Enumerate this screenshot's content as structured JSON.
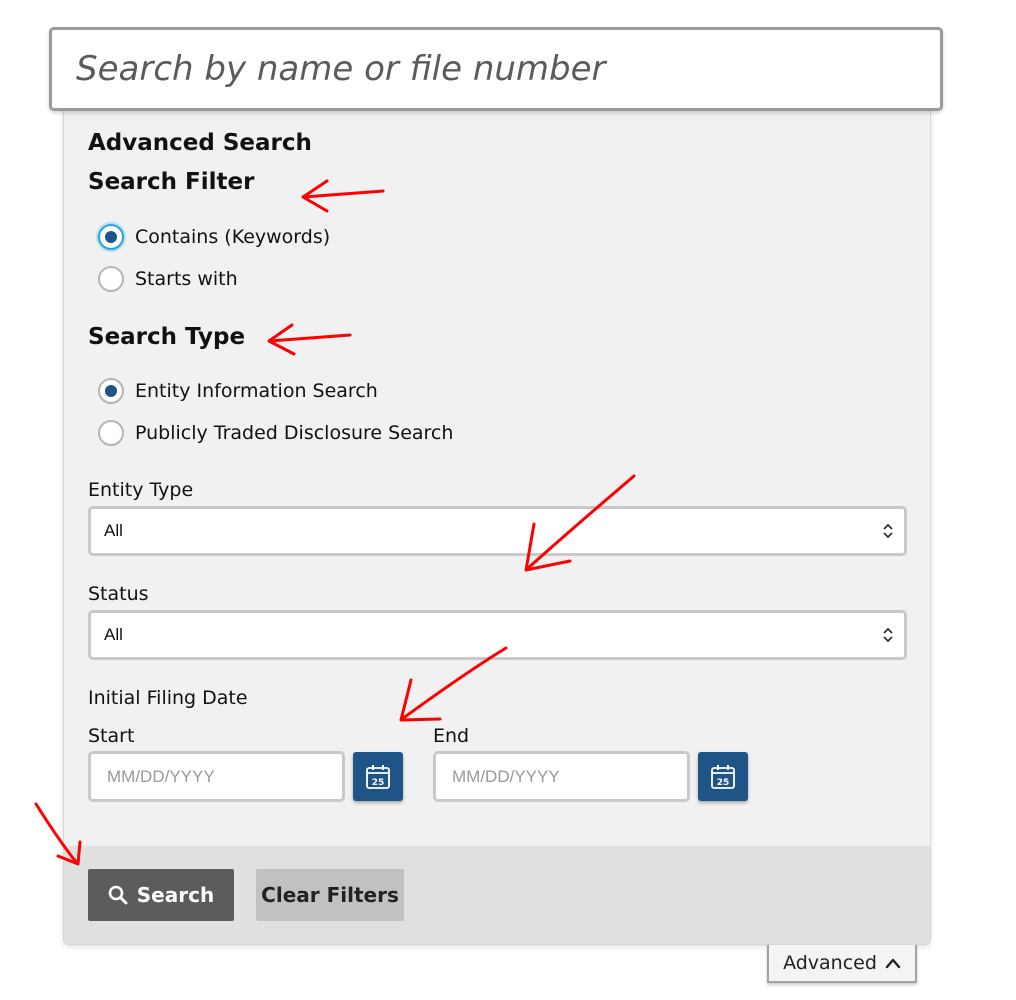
{
  "search": {
    "placeholder": "Search by name or file number"
  },
  "advanced": {
    "title": "Advanced Search",
    "search_filter": {
      "heading": "Search Filter",
      "options": [
        {
          "label": "Contains (Keywords)",
          "selected": true
        },
        {
          "label": "Starts with",
          "selected": false
        }
      ]
    },
    "search_type": {
      "heading": "Search Type",
      "options": [
        {
          "label": "Entity Information Search",
          "selected": true
        },
        {
          "label": "Publicly Traded Disclosure Search",
          "selected": false
        }
      ]
    },
    "entity_type": {
      "label": "Entity Type",
      "value": "All"
    },
    "status": {
      "label": "Status",
      "value": "All"
    },
    "initial_filing_date": {
      "label": "Initial Filing Date",
      "start": {
        "label": "Start",
        "placeholder": "MM/DD/YYYY"
      },
      "end": {
        "label": "End",
        "placeholder": "MM/DD/YYYY"
      },
      "calendar_icon": "calendar-icon",
      "calendar_day": "25"
    },
    "buttons": {
      "search": "Search",
      "clear": "Clear Filters"
    },
    "toggle": {
      "label": "Advanced",
      "icon": "chevron-up-icon"
    }
  },
  "colors": {
    "accent": "#1e5586",
    "focus_ring": "#2aa3d7",
    "annotation": "#ff0000",
    "search_button": "#5c5c5c",
    "clear_button": "#c1c1c1"
  }
}
